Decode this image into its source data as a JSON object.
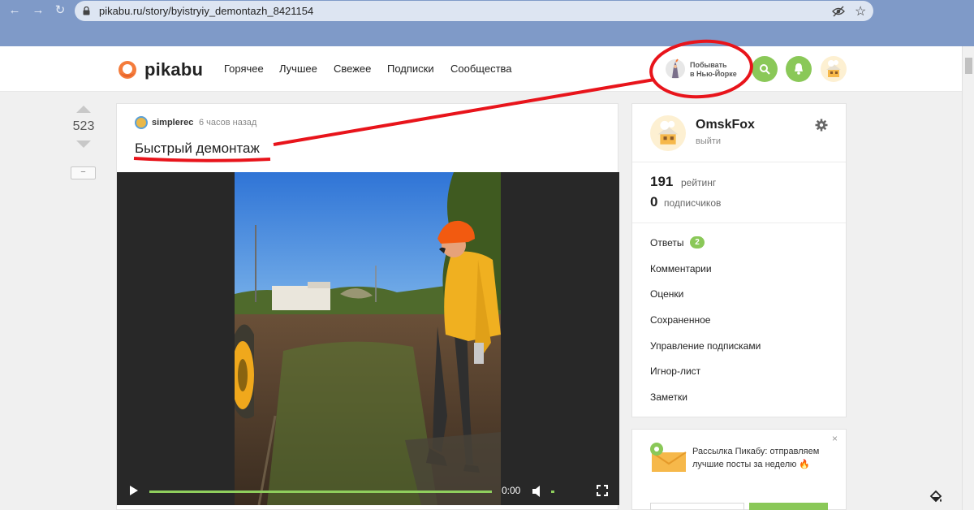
{
  "browser": {
    "url": "pikabu.ru/story/byistryiy_demontazh_8421154",
    "back_icon": "arrow-left-icon",
    "forward_icon": "arrow-right-icon",
    "reload_icon": "reload-icon"
  },
  "header": {
    "logo_text": "pikabu",
    "nav": [
      "Горячее",
      "Лучшее",
      "Свежее",
      "Подписки",
      "Сообщества"
    ],
    "promo_line1": "Побывать",
    "promo_line2": "в Нью-Йорке",
    "accent_color": "#8ac858"
  },
  "story": {
    "rating": "523",
    "collapse_label": "−",
    "author": "simplerec",
    "time": "6 часов назад",
    "title": "Быстрый демонтаж",
    "video_time": "0:00"
  },
  "profile": {
    "name": "OmskFox",
    "logout": "выйти",
    "rating_value": "191",
    "rating_label": "рейтинг",
    "subscribers_value": "0",
    "subscribers_label": "подписчиков",
    "menu": [
      {
        "label": "Ответы",
        "badge": "2"
      },
      {
        "label": "Комментарии"
      },
      {
        "label": "Оценки"
      },
      {
        "label": "Сохраненное"
      },
      {
        "label": "Управление подписками"
      },
      {
        "label": "Игнор-лист"
      },
      {
        "label": "Заметки"
      }
    ]
  },
  "newsletter": {
    "text": "Рассылка Пикабу: отправляем лучшие посты за неделю 🔥",
    "close": "×"
  },
  "annotation_color": "#e8141b"
}
